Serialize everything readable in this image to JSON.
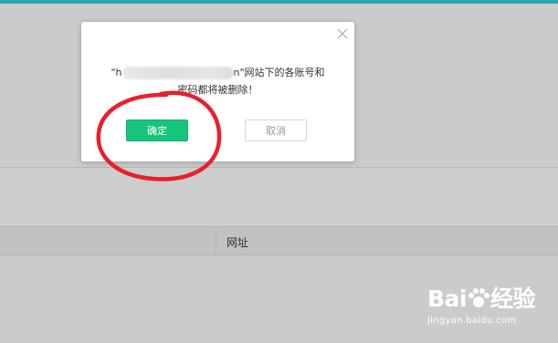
{
  "dialog": {
    "message_prefix": "\"h",
    "message_suffix": "n\"网站下的各账号和",
    "message_line2": "密码都将被删除！",
    "confirm_label": "确定",
    "cancel_label": "取消"
  },
  "table": {
    "column_url": "网址"
  },
  "watermark": {
    "brand_left": "Bai",
    "brand_right": "经验",
    "subtitle": "jingyan.baidu.com"
  },
  "colors": {
    "confirm": "#15c57b",
    "top_bar": "#2aa6b5",
    "annotation": "#e8202a"
  }
}
